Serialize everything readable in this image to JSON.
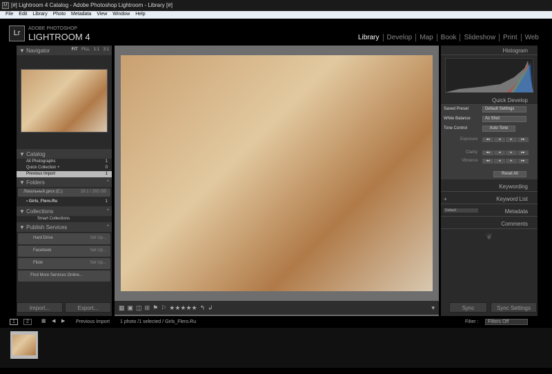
{
  "window": {
    "title": "[#] Lightroom 4 Catalog - Adobe Photoshop Lightroom - Library [#]"
  },
  "menu": [
    "File",
    "Edit",
    "Library",
    "Photo",
    "Metadata",
    "View",
    "Window",
    "Help"
  ],
  "logo": {
    "mark": "Lr",
    "line1": "ADOBE PHOTOSHOP",
    "line2": "LIGHTROOM 4"
  },
  "modules": [
    "Library",
    "Develop",
    "Map",
    "Book",
    "Slideshow",
    "Print",
    "Web"
  ],
  "navigator": {
    "title": "Navigator",
    "zoom": [
      "FIT",
      "FILL",
      "1:1",
      "3:1"
    ]
  },
  "catalog": {
    "title": "Catalog",
    "items": [
      {
        "label": "All Photographs",
        "count": "1"
      },
      {
        "label": "Quick Collection +",
        "count": "0"
      },
      {
        "label": "Previous Import",
        "count": "1"
      }
    ]
  },
  "folders": {
    "title": "Folders",
    "drive": "Локальный диск (C:)",
    "drive_size": "29.1 / 265 GB",
    "folder": "Girls_Flero.Ru",
    "folder_count": "1"
  },
  "collections": {
    "title": "Collections",
    "item": "Smart Collections"
  },
  "publish": {
    "title": "Publish Services",
    "services": [
      {
        "label": "Hard Drive",
        "action": "Set Up..."
      },
      {
        "label": "Facebook",
        "action": "Set Up..."
      },
      {
        "label": "Flickr",
        "action": "Set Up..."
      }
    ],
    "more": "Find More Services Online..."
  },
  "buttons": {
    "import": "Import...",
    "export": "Export...",
    "sync": "Sync",
    "sync_settings": "Sync Settings"
  },
  "histogram": {
    "title": "Histogram"
  },
  "quick_develop": {
    "title": "Quick Develop",
    "saved_preset_label": "Saved Preset",
    "saved_preset": "Default Settings",
    "wb_label": "White Balance",
    "wb": "As Shot",
    "tone_label": "Tone Control",
    "auto_tone": "Auto Tone",
    "exposure": "Exposure",
    "clarity": "Clarity",
    "vibrance": "Vibrance",
    "reset": "Reset All"
  },
  "right_panels": {
    "keywording": "Keywording",
    "keyword_list": "Keyword List",
    "metadata": "Metadata",
    "metadata_preset": "Default",
    "comments": "Comments"
  },
  "toolbar": {
    "stars": "★★★★★"
  },
  "filmstrip": {
    "pages": [
      "1",
      "2"
    ],
    "source": "Previous Import",
    "status": "1 photo /1 selected / Girls_Flero.Ru",
    "filter_label": "Filter :",
    "filter": "Filters Off"
  }
}
